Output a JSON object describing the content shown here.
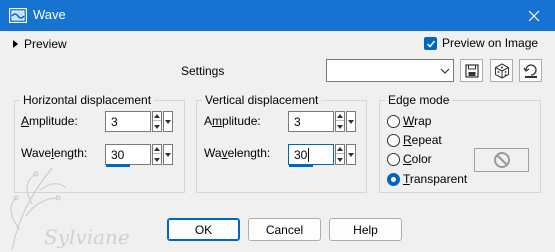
{
  "window": {
    "title": "Wave",
    "app_icon": "psp-wave-icon",
    "close_icon": "close-icon"
  },
  "preview": {
    "label": "Preview",
    "preview_on_image_label": "Preview on Image",
    "preview_on_image_checked": true
  },
  "settings": {
    "label": "Settings",
    "preset_value": ""
  },
  "horizontal": {
    "title": "Horizontal displacement",
    "amplitude_label_pre": "",
    "amplitude_label_u": "A",
    "amplitude_label_post": "mplitude:",
    "amplitude_value": "3",
    "wavelength_label_pre": "Wave",
    "wavelength_label_u": "l",
    "wavelength_label_post": "ength:",
    "wavelength_value": "30"
  },
  "vertical": {
    "title": "Vertical displacement",
    "amplitude_label_pre": "A",
    "amplitude_label_u": "m",
    "amplitude_label_post": "plitude:",
    "amplitude_value": "3",
    "wavelength_label_pre": "Wa",
    "wavelength_label_u": "v",
    "wavelength_label_post": "elength:",
    "wavelength_value": "30"
  },
  "edge_mode": {
    "title": "Edge mode",
    "options": [
      {
        "u": "W",
        "rest": "rap",
        "selected": false
      },
      {
        "u": "R",
        "rest": "epeat",
        "selected": false
      },
      {
        "u": "C",
        "rest": "olor",
        "selected": false
      },
      {
        "u": "T",
        "rest": "ransparent",
        "selected": true
      }
    ]
  },
  "buttons": {
    "ok": "OK",
    "cancel": "Cancel",
    "help": "Help"
  },
  "watermark_text": "Sylviane",
  "colors": {
    "titlebar": "#1773d2",
    "accent": "#0067c0",
    "background": "#f0f0f0"
  }
}
